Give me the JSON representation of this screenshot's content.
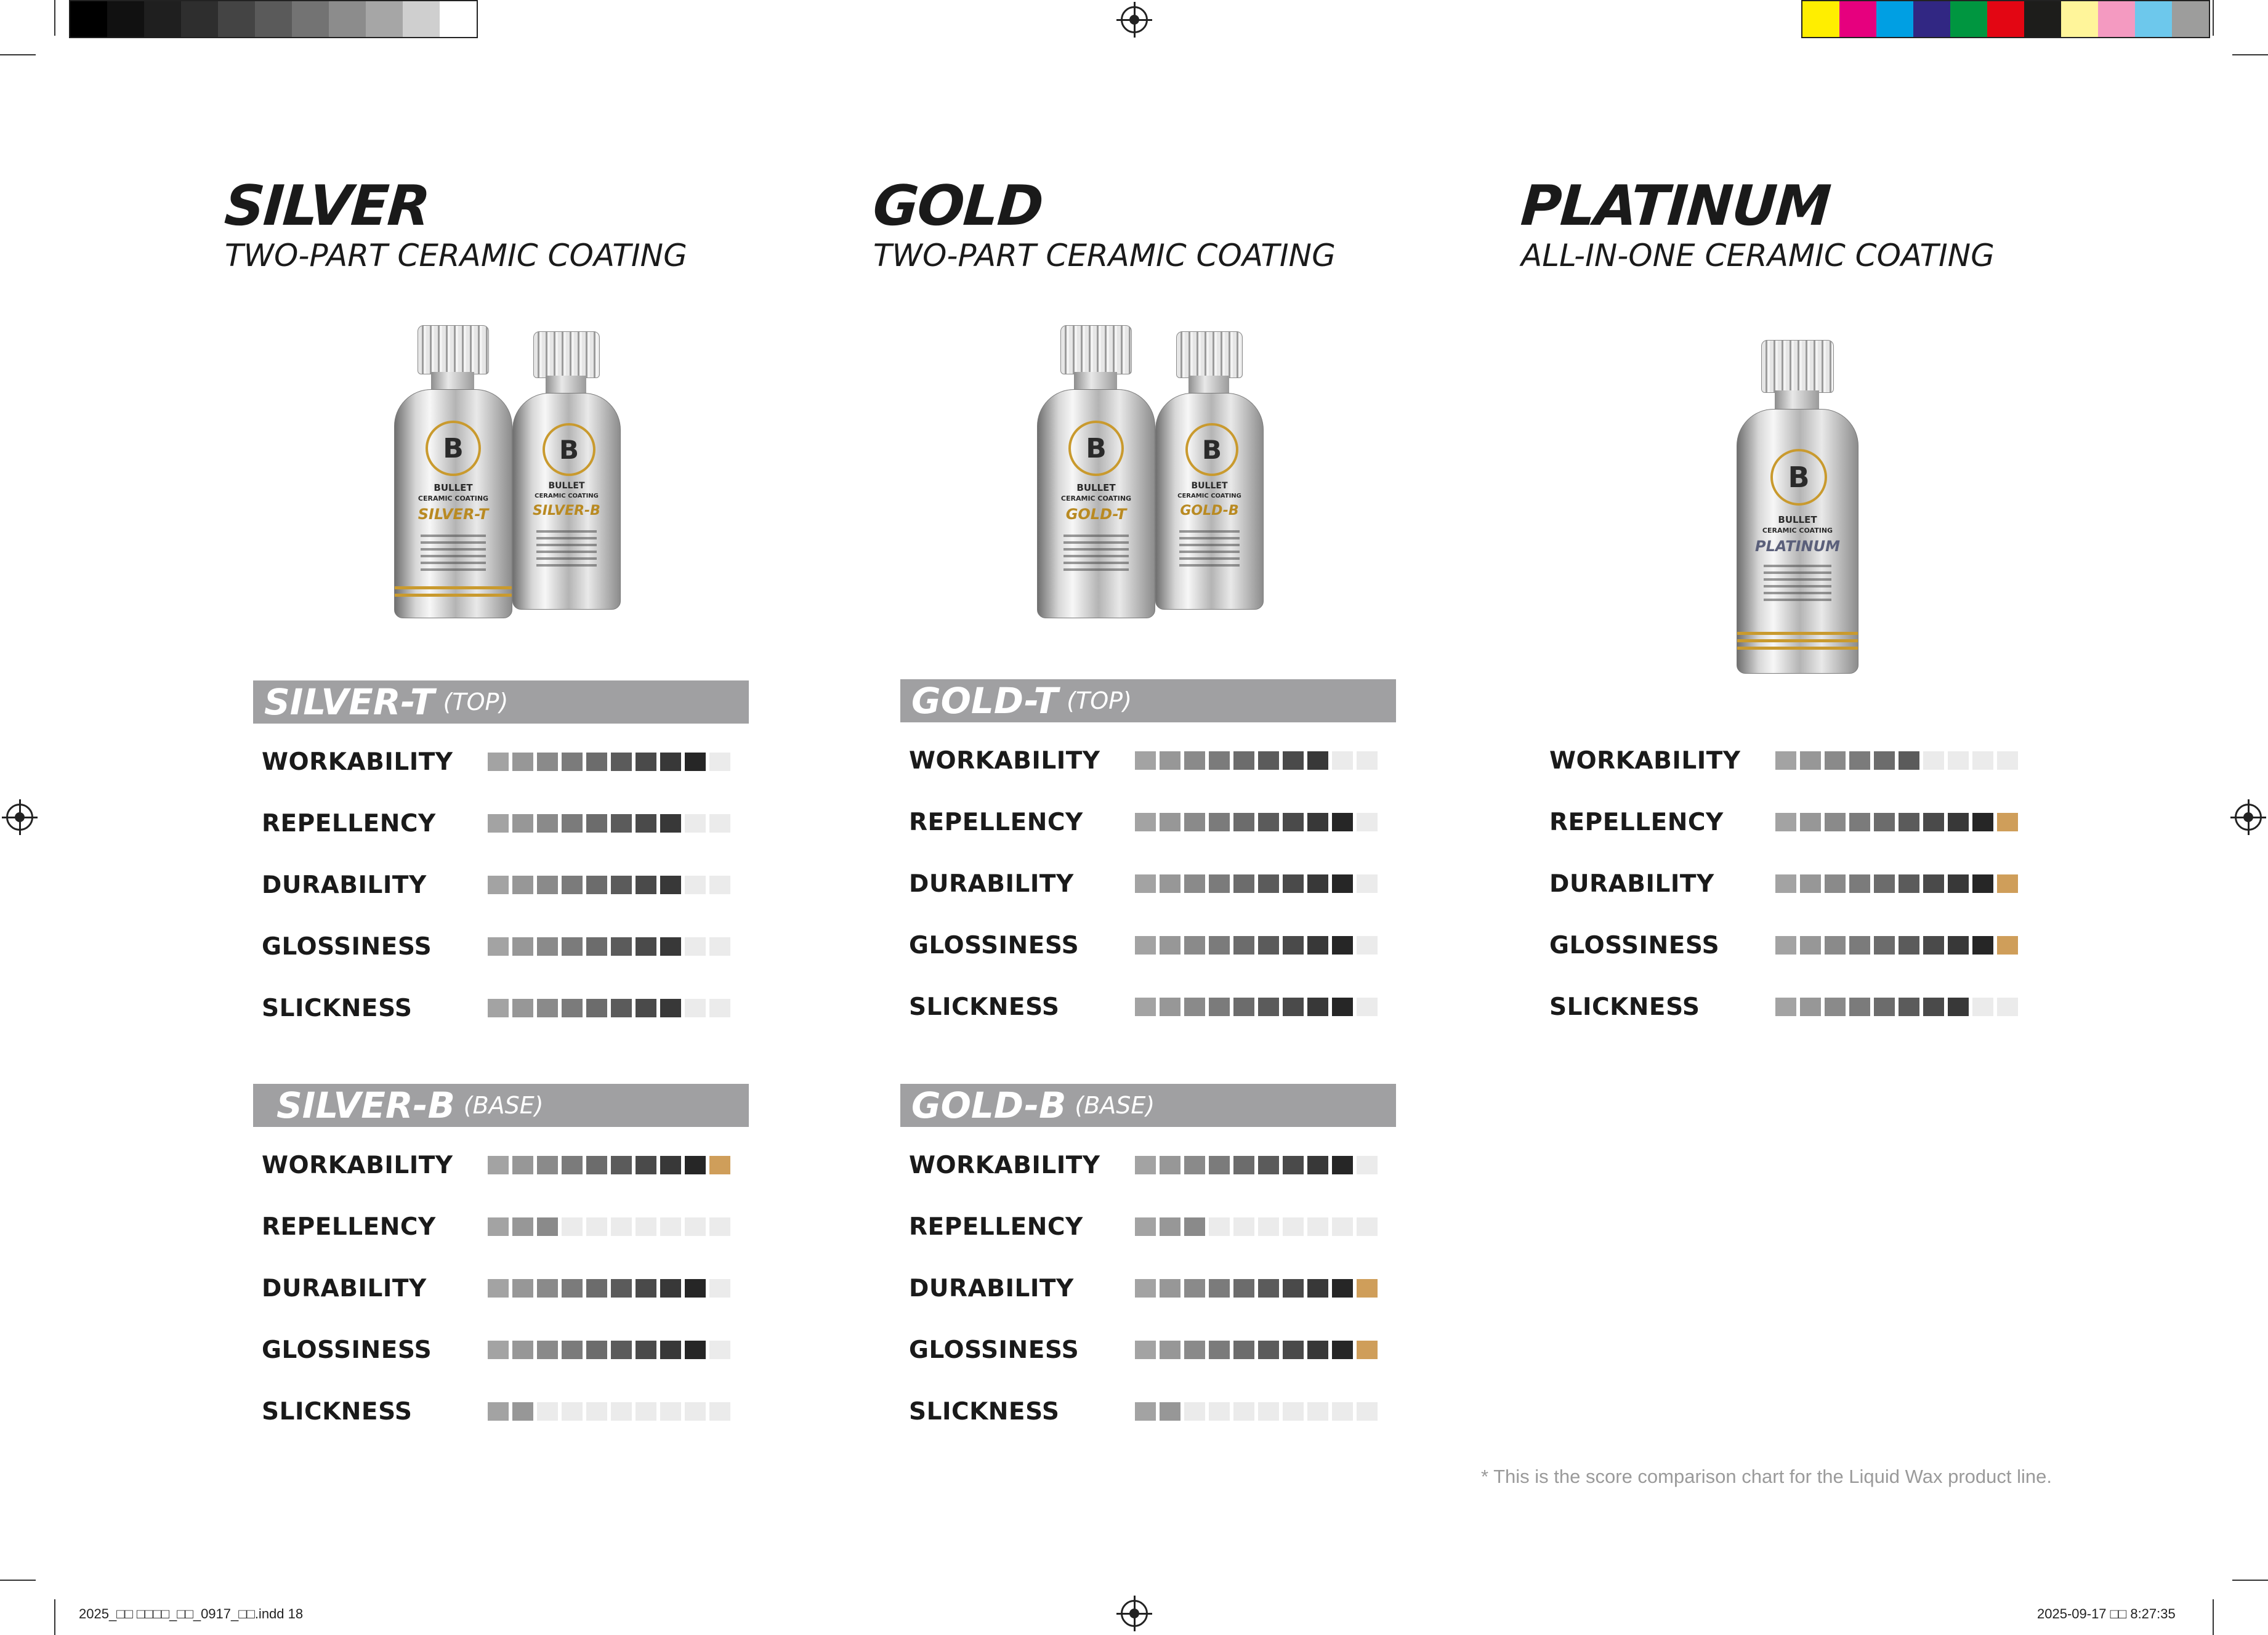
{
  "swatches": {
    "left": [
      "#000000",
      "#111111",
      "#1f1f1f",
      "#2e2e2e",
      "#444444",
      "#5a5a5a",
      "#737373",
      "#8c8c8c",
      "#a6a6a6",
      "#cfcfcf",
      "#ffffff"
    ],
    "right": [
      "#ffee00",
      "#e6007e",
      "#009fe3",
      "#312783",
      "#009640",
      "#e30613",
      "#1d1d1b",
      "#fff59a",
      "#f49ac1",
      "#6dc8ec",
      "#9d9d9c"
    ]
  },
  "footer": {
    "file": "2025_□□ □□□□_□□_0917_□□.indd   18",
    "date": "2025-09-17   □□ 8:27:35"
  },
  "bottle_text": {
    "brand": "BULLET",
    "sub": "CERAMIC COATING",
    "logo": "B"
  },
  "products": [
    {
      "title": "SILVER",
      "subtitle": "TWO-PART CERAMIC COATING",
      "bottle_labels": [
        "SILVER-T",
        "SILVER-B"
      ],
      "sections": [
        {
          "name": "SILVER-T",
          "tag": "(TOP)",
          "metrics": [
            {
              "label": "WORKABILITY",
              "score": 9
            },
            {
              "label": "REPELLENCY",
              "score": 8
            },
            {
              "label": "DURABILITY",
              "score": 8
            },
            {
              "label": "GLOSSINESS",
              "score": 8
            },
            {
              "label": "SLICKNESS",
              "score": 8
            }
          ]
        },
        {
          "name": "SILVER-B",
          "tag": "(BASE)",
          "metrics": [
            {
              "label": "WORKABILITY",
              "score": 10
            },
            {
              "label": "REPELLENCY",
              "score": 3
            },
            {
              "label": "DURABILITY",
              "score": 9
            },
            {
              "label": "GLOSSINESS",
              "score": 9
            },
            {
              "label": "SLICKNESS",
              "score": 2
            }
          ]
        }
      ]
    },
    {
      "title": "GOLD",
      "subtitle": "TWO-PART CERAMIC COATING",
      "bottle_labels": [
        "GOLD-T",
        "GOLD-B"
      ],
      "sections": [
        {
          "name": "GOLD-T",
          "tag": "(TOP)",
          "metrics": [
            {
              "label": "WORKABILITY",
              "score": 8
            },
            {
              "label": "REPELLENCY",
              "score": 9
            },
            {
              "label": "DURABILITY",
              "score": 9
            },
            {
              "label": "GLOSSINESS",
              "score": 9
            },
            {
              "label": "SLICKNESS",
              "score": 9
            }
          ]
        },
        {
          "name": "GOLD-B",
          "tag": "(BASE)",
          "metrics": [
            {
              "label": "WORKABILITY",
              "score": 9
            },
            {
              "label": "REPELLENCY",
              "score": 3
            },
            {
              "label": "DURABILITY",
              "score": 10
            },
            {
              "label": "GLOSSINESS",
              "score": 10
            },
            {
              "label": "SLICKNESS",
              "score": 2
            }
          ]
        }
      ]
    },
    {
      "title": "PLATINUM",
      "subtitle": "ALL-IN-ONE CERAMIC COATING",
      "bottle_labels": [
        "PLATINUM"
      ],
      "sections": [
        {
          "name": "",
          "tag": "",
          "metrics": [
            {
              "label": "WORKABILITY",
              "score": 6
            },
            {
              "label": "REPELLENCY",
              "score": 10
            },
            {
              "label": "DURABILITY",
              "score": 10
            },
            {
              "label": "GLOSSINESS",
              "score": 10
            },
            {
              "label": "SLICKNESS",
              "score": 8
            }
          ]
        }
      ]
    }
  ],
  "colors": {
    "gradient": [
      "#a3a3a3",
      "#979797",
      "#8a8a8a",
      "#7b7b7b",
      "#6c6c6c",
      "#5b5b5b",
      "#4a4a4a",
      "#383838",
      "#262626",
      "#1a1a1a"
    ],
    "perfect": "#cf9e5a",
    "empty": "#ebebeb"
  },
  "note": "* This is the score comparison chart for the Liquid Wax product line."
}
